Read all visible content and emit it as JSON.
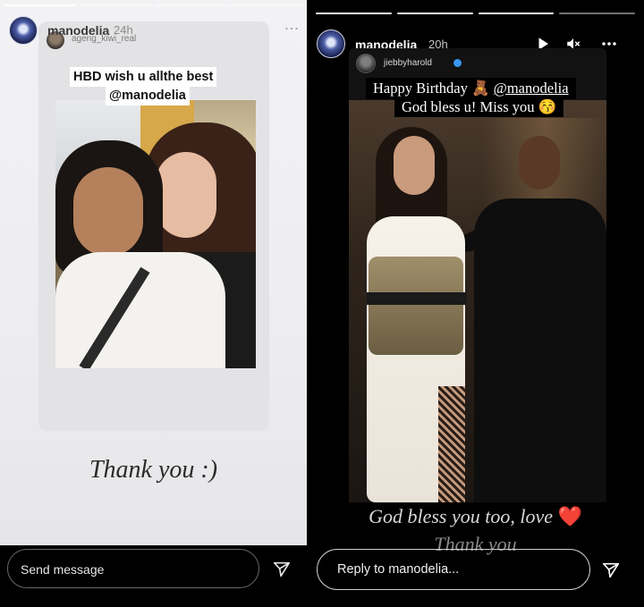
{
  "left_story": {
    "author": "manodelia",
    "time": "24h",
    "shared_from": "ageng_kiwi_real",
    "caption_line1": "HBD wish u allthe best",
    "caption_mention": "@manodelia",
    "reply_text": "Thank you :)",
    "message_placeholder": "Send message",
    "progress_segments": 4,
    "active_segment": 1
  },
  "right_story": {
    "author": "manodelia",
    "time": "20h",
    "shared_from": "jiebbyharold",
    "shared_verified": true,
    "caption_line1_text": "Happy Birthday 🧸 ",
    "caption_mention": "@manodelia",
    "caption_line2": "God bless u! Miss you 😚",
    "reply_line1": "God bless you too, love",
    "reply_heart": "❤️",
    "reply_line2": "Thank you",
    "message_placeholder": "Reply to manodelia...",
    "progress_segments": 4,
    "active_segment": 3
  },
  "icons": {
    "play": "play-icon",
    "mute": "mute-icon",
    "more": "more-icon",
    "send": "send-icon"
  },
  "colors": {
    "verified": "#3897f0",
    "heart": "#e53935"
  }
}
